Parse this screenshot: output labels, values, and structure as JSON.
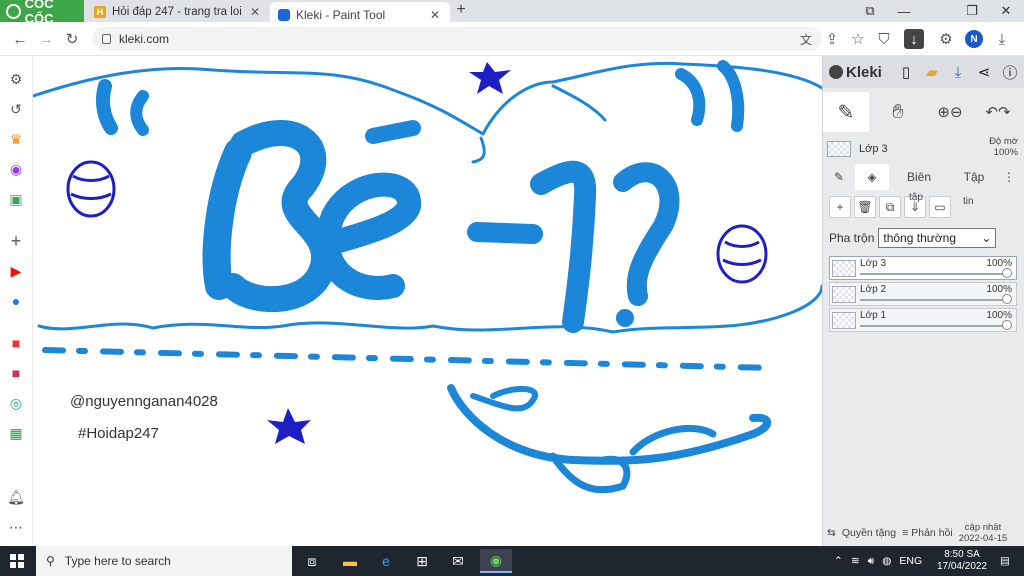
{
  "browser": {
    "brand_name": "CỐC CỐC",
    "tabs": [
      {
        "title": "Hỏi đáp 247 - trang tra loi",
        "favicon": "H"
      },
      {
        "title": "Kleki - Paint Tool"
      }
    ],
    "url": "kleki.com",
    "profile_initial": "N",
    "colors": {
      "brand_green": "#3fa648",
      "accent_blue": "#1a57c9"
    }
  },
  "sidebar": {
    "icons": [
      "settings-icon",
      "history-icon",
      "crown-icon",
      "messenger-icon",
      "games-icon",
      "add-icon",
      "youtube-icon",
      "facebook-icon",
      "shop-icon",
      "game-thumb-icon",
      "maps-icon",
      "sheets-icon",
      "bell-icon",
      "more-icon"
    ]
  },
  "canvas": {
    "watermark_user": "@nguyennganan4028",
    "watermark_tag": "#Hoidap247",
    "colors": {
      "stroke_blue": "#1c86d8",
      "star_navy": "#1d1fc4"
    }
  },
  "kleki": {
    "logo": "Kleki",
    "current_layer": {
      "name": "Lớp 3",
      "opacity_label": "Độ mờ",
      "opacity_value": "100%"
    },
    "tabs": [
      "Biên",
      "Tập"
    ],
    "action_labels": {
      "label_a": "tập",
      "label_b": "tin"
    },
    "blend": {
      "label": "Pha trộn",
      "value": "thông thường"
    },
    "layers": [
      {
        "name": "Lớp 3",
        "opacity": "100%",
        "active": true
      },
      {
        "name": "Lớp 2",
        "opacity": "100%",
        "active": false
      },
      {
        "name": "Lớp 1",
        "opacity": "100%",
        "active": false
      }
    ],
    "footer": {
      "privacy": "Quyền tặng",
      "feedback": "Phản hồi",
      "update_line1": "cập nhật",
      "update_line2": "2022-04-15"
    }
  },
  "taskbar": {
    "search_placeholder": "Type here to search",
    "language": "ENG",
    "time": "8:50 SA",
    "date": "17/04/2022"
  }
}
